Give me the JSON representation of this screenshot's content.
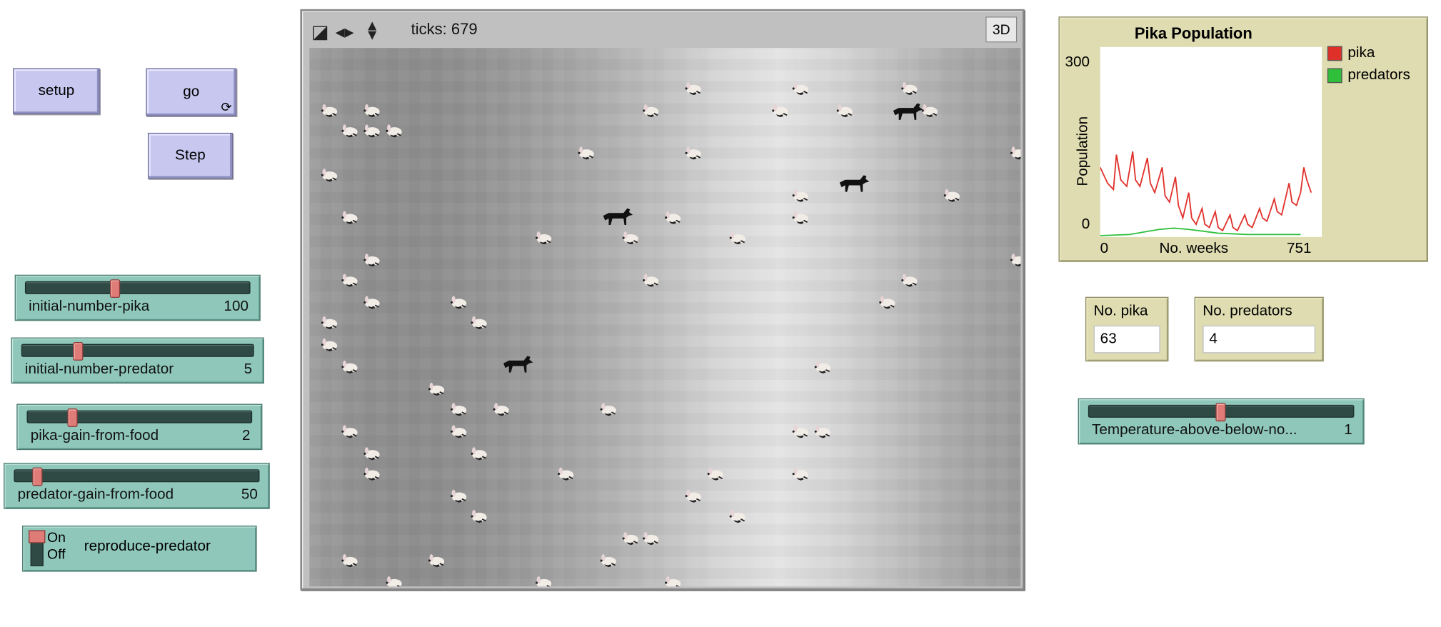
{
  "buttons": {
    "setup": "setup",
    "go": "go",
    "step": "Step",
    "forever_glyph": "⟳"
  },
  "sliders": [
    {
      "label": "initial-number-pika",
      "value": "100",
      "fraction": 0.4
    },
    {
      "label": "initial-number-predator",
      "value": "5",
      "fraction": 0.24
    },
    {
      "label": "pika-gain-from-food",
      "value": "2",
      "fraction": 0.21
    },
    {
      "label": "predator-gain-from-food",
      "value": "50",
      "fraction": 0.09
    }
  ],
  "switch": {
    "on": "On",
    "off": "Off",
    "label": "reproduce-predator"
  },
  "view": {
    "ticks_label": "ticks: 679",
    "btn_3d": "3D",
    "icons": [
      "view-mode-icon",
      "horizontal-arrows-icon",
      "vertical-arrows-icon"
    ],
    "pika_count_shown": 63,
    "predator_count_shown": 4
  },
  "plot": {
    "title": "Pika Population",
    "y_max": "300",
    "y_min": "0",
    "y_label": "Population",
    "x_min": "0",
    "x_label": "No. weeks",
    "x_max": "751",
    "legend": [
      {
        "name": "pika",
        "color": "#e0302a"
      },
      {
        "name": "predators",
        "color": "#2fbf3a"
      }
    ]
  },
  "chart_data": {
    "type": "line",
    "title": "Pika Population",
    "xlabel": "No. weeks",
    "ylabel": "Population",
    "xlim": [
      0,
      751
    ],
    "ylim": [
      0,
      300
    ],
    "series": [
      {
        "name": "pika",
        "color": "#e0302a",
        "x": [
          0,
          25,
          45,
          55,
          70,
          90,
          110,
          120,
          135,
          160,
          170,
          185,
          210,
          220,
          235,
          255,
          265,
          280,
          300,
          310,
          325,
          345,
          355,
          370,
          390,
          400,
          415,
          440,
          450,
          465,
          490,
          500,
          515,
          540,
          550,
          565,
          590,
          600,
          615,
          640,
          650,
          665,
          690,
          700,
          715,
          679
        ],
        "y": [
          110,
          85,
          75,
          130,
          90,
          80,
          135,
          90,
          80,
          125,
          85,
          70,
          110,
          65,
          55,
          95,
          50,
          30,
          70,
          30,
          20,
          45,
          20,
          15,
          40,
          15,
          10,
          35,
          15,
          10,
          35,
          20,
          15,
          45,
          30,
          25,
          60,
          40,
          35,
          85,
          55,
          50,
          110,
          90,
          70,
          70
        ]
      },
      {
        "name": "predators",
        "color": "#2fbf3a",
        "x": [
          0,
          50,
          100,
          150,
          200,
          250,
          300,
          350,
          400,
          450,
          500,
          550,
          600,
          650,
          679
        ],
        "y": [
          2,
          3,
          4,
          8,
          12,
          14,
          12,
          9,
          6,
          5,
          4,
          4,
          4,
          4,
          4
        ]
      }
    ]
  },
  "monitors": [
    {
      "label": "No. pika",
      "value": "63"
    },
    {
      "label": "No. predators",
      "value": "4"
    }
  ],
  "temp_slider": {
    "label": "Temperature-above-below-no...",
    "value": "1",
    "fraction": 0.5
  }
}
